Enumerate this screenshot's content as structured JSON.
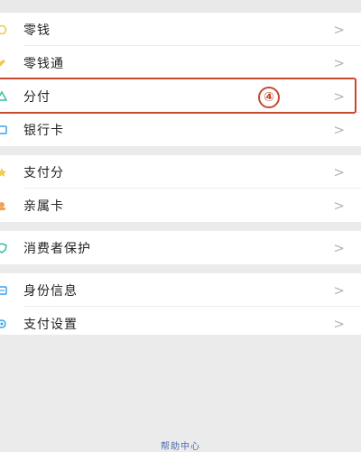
{
  "groups": [
    {
      "items": [
        {
          "label": "零钱",
          "icon": "wallet-icon",
          "color": "#f2c94c"
        },
        {
          "label": "零钱通",
          "icon": "coin-icon",
          "color": "#f2c94c"
        },
        {
          "label": "分付",
          "icon": "fenfu-icon",
          "color": "#3bbfa5"
        },
        {
          "label": "银行卡",
          "icon": "card-icon",
          "color": "#3aa3e8"
        }
      ]
    },
    {
      "items": [
        {
          "label": "支付分",
          "icon": "score-icon",
          "color": "#f2c94c"
        },
        {
          "label": "亲属卡",
          "icon": "family-card-icon",
          "color": "#f2a14c"
        }
      ]
    },
    {
      "items": [
        {
          "label": "消费者保护",
          "icon": "shield-icon",
          "color": "#3bbfa5"
        }
      ]
    },
    {
      "items": [
        {
          "label": "身份信息",
          "icon": "id-icon",
          "color": "#3aa3e8"
        },
        {
          "label": "支付设置",
          "icon": "settings-icon",
          "color": "#3aa3e8"
        }
      ]
    }
  ],
  "chevron": ">",
  "annotation": {
    "step": "④",
    "color": "#c9482f"
  },
  "footer": {
    "help": "帮助中心"
  }
}
